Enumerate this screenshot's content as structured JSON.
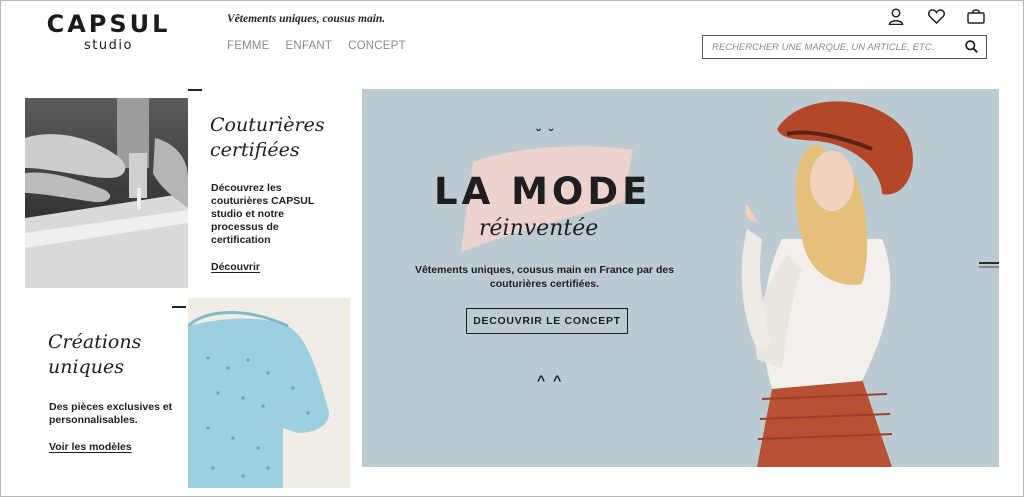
{
  "brand": {
    "name": "CAPSUL",
    "sub": "studio"
  },
  "header": {
    "tagline": "Vêtements uniques, cousus main.",
    "nav": [
      "FEMME",
      "ENFANT",
      "CONCEPT"
    ],
    "search_placeholder": "RECHERCHER UNE MARQUE, UN ARTICLE, ETC.",
    "icons": [
      "user-icon",
      "heart-icon",
      "bag-icon",
      "search-icon"
    ]
  },
  "tiles": {
    "couturieres": {
      "title_line1": "Couturières",
      "title_line2": "certifiées",
      "description": "Découvrez les couturières CAPSUL studio et notre processus de certification",
      "link": "Découvrir"
    },
    "creations": {
      "title_line1": "Créations",
      "title_line2": "uniques",
      "description": "Des pièces exclusives et personnalisables.",
      "link": "Voir les modèles"
    }
  },
  "hero": {
    "title": "LA MODE",
    "script": "réinventée",
    "subtitle": "Vêtements uniques, cousus main en France par des couturières certifiées.",
    "cta": "DECOUVRIR LE CONCEPT",
    "chevron_top": "ˇ ˇ",
    "chevron_bottom": "^ ^"
  },
  "colors": {
    "hero_bg": "#bccbd1",
    "brush": "#ecd3cd",
    "hat": "#b4472a",
    "skirt": "#b95034",
    "dress": "#9ccfe0"
  }
}
